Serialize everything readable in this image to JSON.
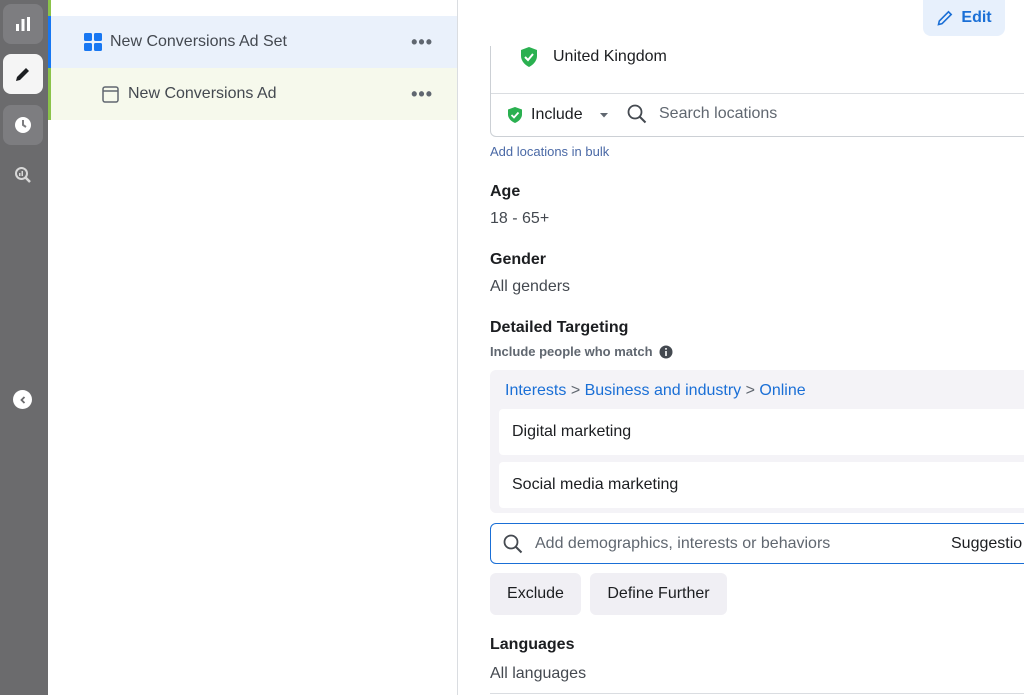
{
  "rail": {
    "icons": [
      "bar-chart-icon",
      "pencil-icon",
      "clock-icon",
      "zoom-chart-icon"
    ],
    "collapse_icon": "chevron-left-icon"
  },
  "tree": {
    "adset_label": "New Conversions Ad Set",
    "ad_label": "New Conversions Ad",
    "more_glyph": "•••"
  },
  "header": {
    "edit_label": "Edit"
  },
  "locations": {
    "country": "United Kingdom",
    "include_label": "Include",
    "search_placeholder": "Search locations",
    "bulk_link": "Add locations in bulk"
  },
  "age": {
    "label": "Age",
    "value": "18 - 65+"
  },
  "gender": {
    "label": "Gender",
    "value": "All genders"
  },
  "detailed_targeting": {
    "label": "Detailed Targeting",
    "sublabel": "Include people who match",
    "crumbs": [
      "Interests",
      "Business and industry",
      "Online"
    ],
    "separator": ">",
    "items": [
      "Digital marketing",
      "Social media marketing"
    ],
    "search_placeholder": "Add demographics, interests or behaviors",
    "suggestions_label": "Suggestio",
    "exclude_label": "Exclude",
    "define_further_label": "Define Further"
  },
  "languages": {
    "label": "Languages",
    "value": "All languages"
  },
  "colors": {
    "accent_blue": "#1a6fd6",
    "green_check": "#2ab050",
    "rail_bg": "#6b6b6d"
  }
}
